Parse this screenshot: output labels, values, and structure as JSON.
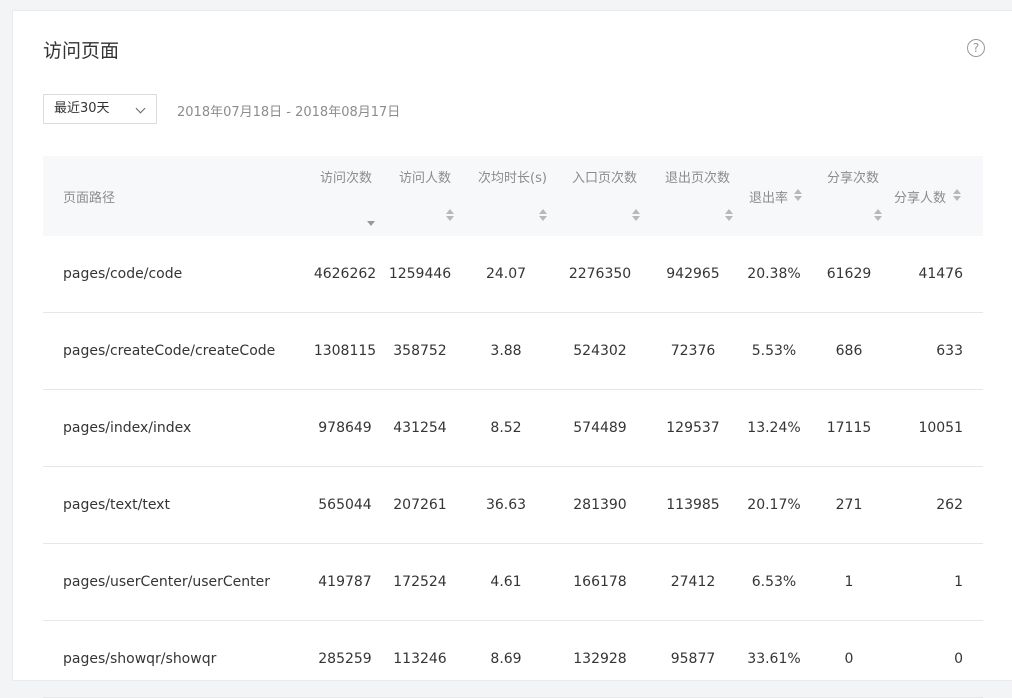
{
  "page": {
    "title": "访问页面",
    "help_icon": "question-circle-icon"
  },
  "filter": {
    "range_label": "最近30天",
    "date_range": "2018年07月18日 - 2018年08月17日"
  },
  "table": {
    "columns": [
      "页面路径",
      "访问次数",
      "访问人数",
      "次均时长(s)",
      "入口页次数",
      "退出页次数",
      "退出率",
      "分享次数",
      "分享人数"
    ],
    "rows": [
      [
        "pages/code/code",
        "4626262",
        "1259446",
        "24.07",
        "2276350",
        "942965",
        "20.38%",
        "61629",
        "41476"
      ],
      [
        "pages/createCode/createCode",
        "1308115",
        "358752",
        "3.88",
        "524302",
        "72376",
        "5.53%",
        "686",
        "633"
      ],
      [
        "pages/index/index",
        "978649",
        "431254",
        "8.52",
        "574489",
        "129537",
        "13.24%",
        "17115",
        "10051"
      ],
      [
        "pages/text/text",
        "565044",
        "207261",
        "36.63",
        "281390",
        "113985",
        "20.17%",
        "271",
        "262"
      ],
      [
        "pages/userCenter/userCenter",
        "419787",
        "172524",
        "4.61",
        "166178",
        "27412",
        "6.53%",
        "1",
        "1"
      ],
      [
        "pages/showqr/showqr",
        "285259",
        "113246",
        "8.69",
        "132928",
        "95877",
        "33.61%",
        "0",
        "0"
      ]
    ]
  }
}
